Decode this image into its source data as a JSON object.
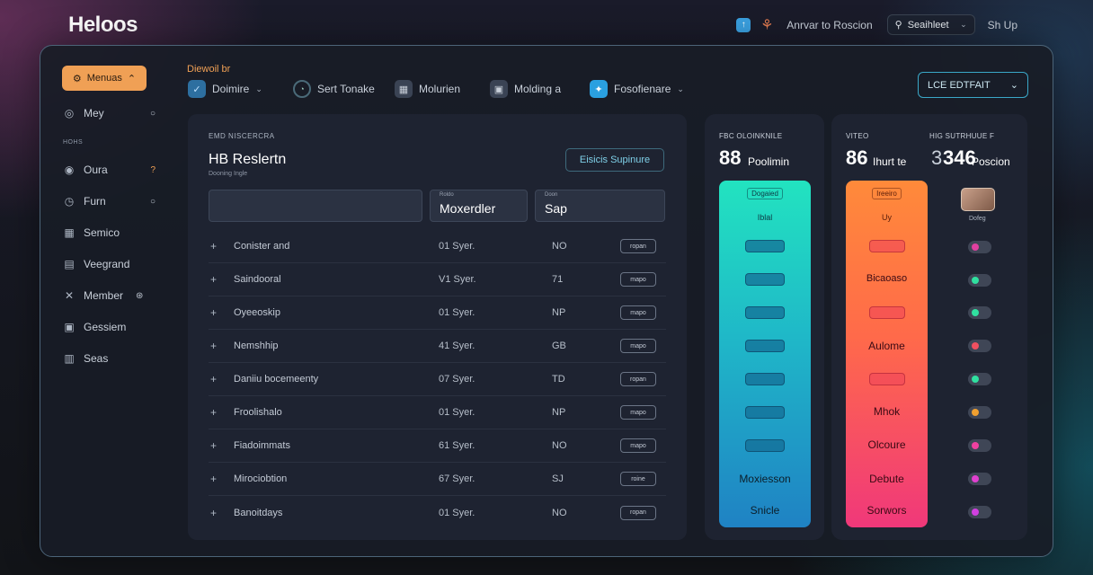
{
  "app": {
    "title": "Heloos"
  },
  "topbar": {
    "link_label": "Anrvar to Roscion",
    "search_value": "Seaihleet",
    "signup_label": "Sh Up"
  },
  "sidebar": {
    "menu_label": "Menuas",
    "subheading": "HOHS",
    "items": [
      {
        "label": "Mey",
        "icon": "user-icon",
        "trail": "○"
      },
      {
        "label": "Oura",
        "icon": "user-icon",
        "trail": "?"
      },
      {
        "label": "Furn",
        "icon": "clock-icon",
        "trail": "○"
      },
      {
        "label": "Semico",
        "icon": "grid-icon",
        "trail": ""
      },
      {
        "label": "Veegrand",
        "icon": "window-icon",
        "trail": ""
      },
      {
        "label": "Member",
        "icon": "close-icon",
        "trail": "⊛"
      },
      {
        "label": "Gessiem",
        "icon": "calendar-icon",
        "trail": ""
      },
      {
        "label": "Seas",
        "icon": "table-icon",
        "trail": ""
      }
    ]
  },
  "toolbar": {
    "label": "Diewoil br",
    "items": [
      {
        "label": "Doimire",
        "icon": "check-icon",
        "has_menu": true
      },
      {
        "label": "Sert Tonake",
        "icon": "chat-icon",
        "has_menu": false
      },
      {
        "label": "Molurien",
        "icon": "grid-icon",
        "has_menu": false
      },
      {
        "label": "Molding a",
        "icon": "panel-icon",
        "has_menu": false
      },
      {
        "label": "Fosofienare",
        "icon": "twitter-icon",
        "has_menu": true
      }
    ],
    "dropdown_label": "LCE EDTFAIT"
  },
  "main_card": {
    "kicker": "EMD NISCERCRA",
    "title": "HB Reslertn",
    "subtitle": "Dooning Ingle",
    "action_label": "Eisicis Supinure",
    "fields": [
      {
        "label": "",
        "value": ""
      },
      {
        "label": "Roldo",
        "value": "Moxerdler"
      },
      {
        "label": "Doon",
        "value": "Sap"
      }
    ],
    "rows": [
      {
        "name": "Conister and",
        "time": "01 Syer.",
        "code": "NO",
        "pill": "ropan"
      },
      {
        "name": "Saindooral",
        "time": "V1 Syer.",
        "code": "71",
        "pill": "mapo"
      },
      {
        "name": "Oyeeoskip",
        "time": "01 Syer.",
        "code": "NP",
        "pill": "mapo"
      },
      {
        "name": "Nemshhip",
        "time": "41 Syer.",
        "code": "GB",
        "pill": "mapo"
      },
      {
        "name": "Daniiu bocemeenty",
        "time": "07 Syer.",
        "code": "TD",
        "pill": "ropan"
      },
      {
        "name": "Froolishalo",
        "time": "01 Syer.",
        "code": "NP",
        "pill": "mapo"
      },
      {
        "name": "Fiadoimmats",
        "time": "61 Syer.",
        "code": "NO",
        "pill": "mapo"
      },
      {
        "name": "Mirociobtion",
        "time": "67 Syer.",
        "code": "SJ",
        "pill": "roine"
      },
      {
        "name": "Banoitdays",
        "time": "01 Syer.",
        "code": "NO",
        "pill": "ropan"
      }
    ]
  },
  "stat_teal": {
    "label": "FBC OLOINKNILE",
    "number": "88",
    "unit": "Poolimin",
    "bar_head": "Dogaied",
    "bar_head2": "Iblal",
    "slot_count": 7,
    "bottom_texts": [
      "Moxiesson",
      "Snicle"
    ]
  },
  "stat_warm": {
    "label": "VITEO",
    "number": "86",
    "unit": "Ihurt te",
    "bar_head": "Ireeiro",
    "bar_head2": "Uy",
    "texts": [
      "Bicaoaso",
      "Aulome",
      "Mhok",
      "Olcoure",
      "Debute",
      "Sorwors"
    ]
  },
  "stat_right": {
    "label": "HIG SUTRHUUE F",
    "number": "346",
    "prefix": "3",
    "unit": "Poscion",
    "avatar_caption": "Dofeg",
    "toggle_colors": [
      "#e040a0",
      "#30e0a0",
      "#30e0a0",
      "#f05060",
      "#30e0a0",
      "#f0a030",
      "#f040a0",
      "#e040d0",
      "#d040e0"
    ]
  },
  "colors": {
    "accent_orange": "#f0a055",
    "accent_cyan": "#3aa8c8"
  }
}
